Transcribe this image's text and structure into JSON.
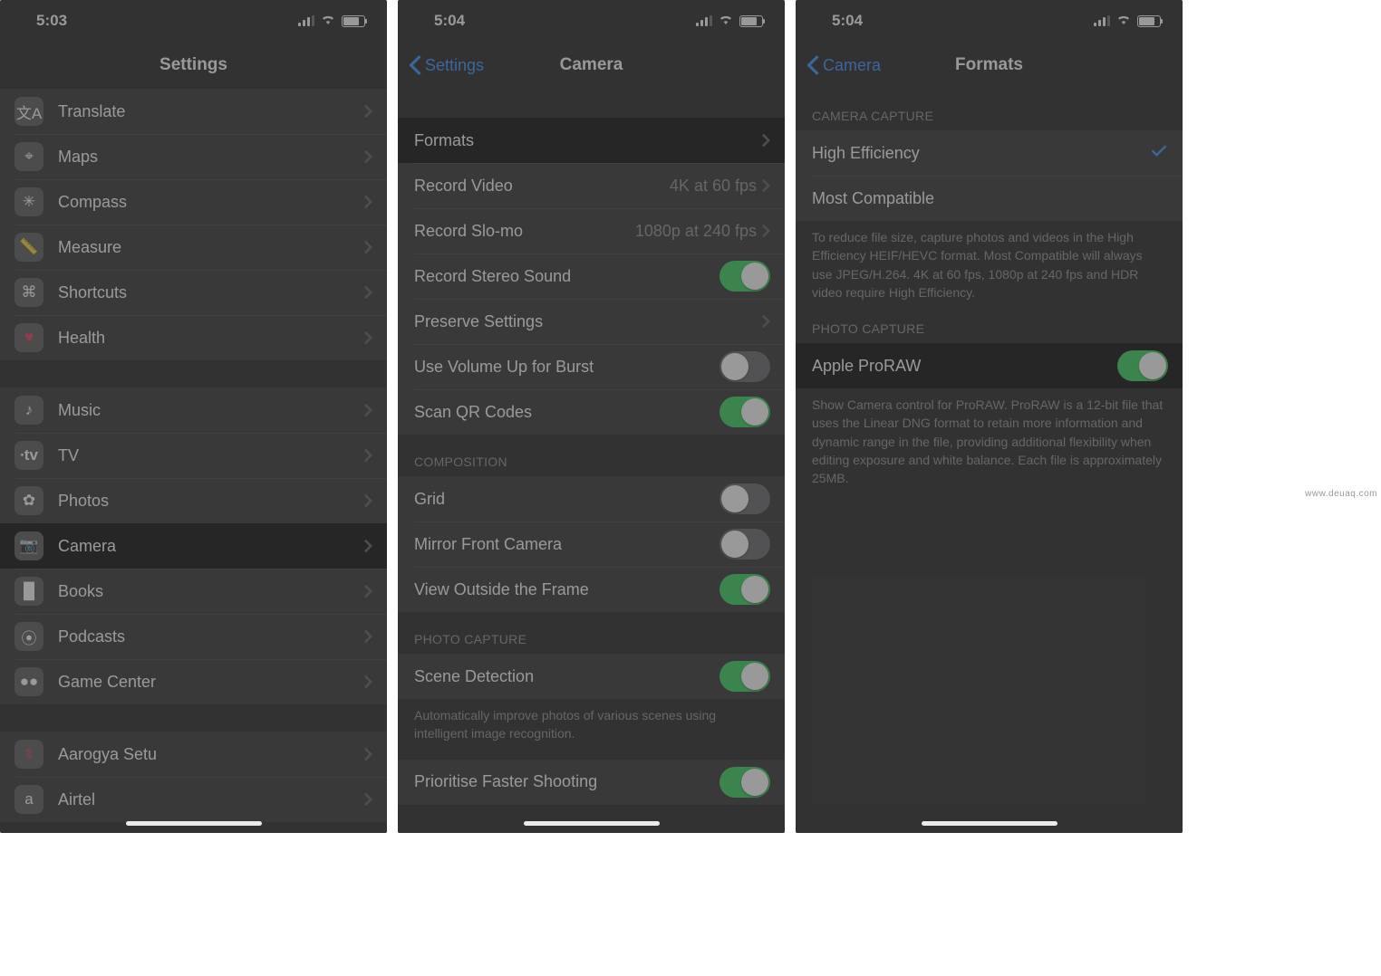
{
  "watermark": "www.deuaq.com",
  "screen1": {
    "time": "5:03",
    "title": "Settings",
    "group1": [
      {
        "id": "translate",
        "label": "Translate"
      },
      {
        "id": "maps",
        "label": "Maps"
      },
      {
        "id": "compass",
        "label": "Compass"
      },
      {
        "id": "measure",
        "label": "Measure"
      },
      {
        "id": "shortcuts",
        "label": "Shortcuts"
      },
      {
        "id": "health",
        "label": "Health"
      }
    ],
    "group2": [
      {
        "id": "music",
        "label": "Music"
      },
      {
        "id": "tv",
        "label": "TV"
      },
      {
        "id": "photos",
        "label": "Photos"
      },
      {
        "id": "camera",
        "label": "Camera",
        "highlight": true
      },
      {
        "id": "books",
        "label": "Books"
      },
      {
        "id": "podcasts",
        "label": "Podcasts"
      },
      {
        "id": "gamecenter",
        "label": "Game Center"
      }
    ],
    "group3": [
      {
        "id": "aarogya",
        "label": "Aarogya Setu"
      },
      {
        "id": "airtel",
        "label": "Airtel"
      }
    ]
  },
  "screen2": {
    "time": "5:04",
    "back": "Settings",
    "title": "Camera",
    "rows": [
      {
        "label": "Formats",
        "highlight": true
      },
      {
        "label": "Record Video",
        "value": "4K at 60 fps"
      },
      {
        "label": "Record Slo-mo",
        "value": "1080p at 240 fps"
      },
      {
        "label": "Record Stereo Sound",
        "toggle": true,
        "on": true
      },
      {
        "label": "Preserve Settings"
      },
      {
        "label": "Use Volume Up for Burst",
        "toggle": true,
        "on": false
      },
      {
        "label": "Scan QR Codes",
        "toggle": true,
        "on": true
      }
    ],
    "sec2_header": "COMPOSITION",
    "rows2": [
      {
        "label": "Grid",
        "toggle": true,
        "on": false
      },
      {
        "label": "Mirror Front Camera",
        "toggle": true,
        "on": false
      },
      {
        "label": "View Outside the Frame",
        "toggle": true,
        "on": true
      }
    ],
    "sec3_header": "PHOTO CAPTURE",
    "rows3": [
      {
        "label": "Scene Detection",
        "toggle": true,
        "on": true
      }
    ],
    "sec3_footer": "Automatically improve photos of various scenes using intelligent image recognition.",
    "rows4": [
      {
        "label": "Prioritise Faster Shooting",
        "toggle": true,
        "on": true
      }
    ]
  },
  "screen3": {
    "time": "5:04",
    "back": "Camera",
    "title": "Formats",
    "sec1_header": "CAMERA CAPTURE",
    "rows1": [
      {
        "label": "High Efficiency",
        "checked": true
      },
      {
        "label": "Most Compatible",
        "checked": false
      }
    ],
    "sec1_footer": "To reduce file size, capture photos and videos in the High Efficiency HEIF/HEVC format. Most Compatible will always use JPEG/H.264. 4K at 60 fps, 1080p at 240 fps and HDR video require High Efficiency.",
    "sec2_header": "PHOTO CAPTURE",
    "rows2": [
      {
        "label": "Apple ProRAW",
        "toggle": true,
        "on": true,
        "highlight": true
      }
    ],
    "sec2_footer": "Show Camera control for ProRAW. ProRAW is a 12-bit file that uses the Linear DNG format to retain more information and dynamic range in the file, providing additional flexibility when editing exposure and white balance. Each file is approximately 25MB."
  }
}
